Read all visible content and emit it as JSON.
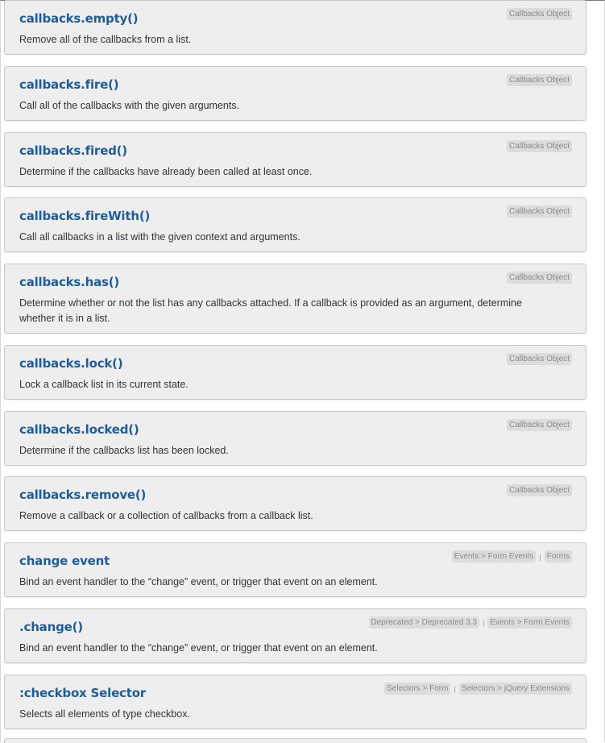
{
  "entries": [
    {
      "title": "callbacks.empty()",
      "description": "Remove all of the callbacks from a list.",
      "categories": [
        "Callbacks Object"
      ]
    },
    {
      "title": "callbacks.fire()",
      "description": "Call all of the callbacks with the given arguments.",
      "categories": [
        "Callbacks Object"
      ]
    },
    {
      "title": "callbacks.fired()",
      "description": "Determine if the callbacks have already been called at least once.",
      "categories": [
        "Callbacks Object"
      ]
    },
    {
      "title": "callbacks.fireWith()",
      "description": "Call all callbacks in a list with the given context and arguments.",
      "categories": [
        "Callbacks Object"
      ]
    },
    {
      "title": "callbacks.has()",
      "description": "Determine whether or not the list has any callbacks attached. If a callback is provided as an argument, determine whether it is in a list.",
      "categories": [
        "Callbacks Object"
      ]
    },
    {
      "title": "callbacks.lock()",
      "description": "Lock a callback list in its current state.",
      "categories": [
        "Callbacks Object"
      ]
    },
    {
      "title": "callbacks.locked()",
      "description": "Determine if the callbacks list has been locked.",
      "categories": [
        "Callbacks Object"
      ]
    },
    {
      "title": "callbacks.remove()",
      "description": "Remove a callback or a collection of callbacks from a callback list.",
      "categories": [
        "Callbacks Object"
      ]
    },
    {
      "title": "change event",
      "description": "Bind an event handler to the “change” event, or trigger that event on an element.",
      "categories": [
        "Events > Form Events",
        "Forms"
      ]
    },
    {
      "title": ".change()",
      "description": "Bind an event handler to the “change” event, or trigger that event on an element.",
      "categories": [
        "Deprecated > Deprecated 3.3",
        "Events > Form Events"
      ]
    },
    {
      "title": ":checkbox Selector",
      "description": "Selects all elements of type checkbox.",
      "categories": [
        "Selectors > Form",
        "Selectors > jQuery Extensions"
      ]
    }
  ],
  "colors": {
    "title": "#1e5d9b",
    "card_bg": "#eeeeee",
    "tag_bg": "#dcdcdc"
  }
}
